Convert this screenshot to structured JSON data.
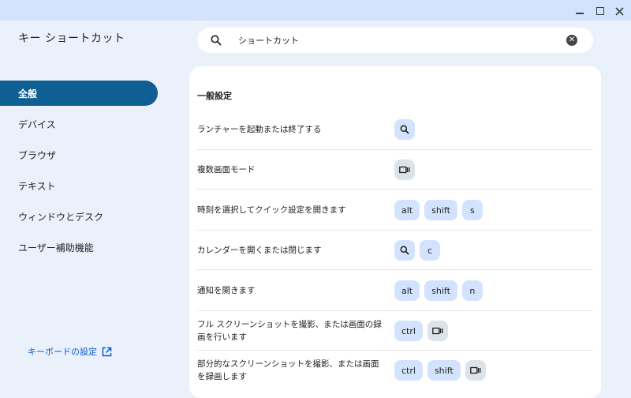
{
  "window": {
    "title": "キー ショートカット"
  },
  "sidebar": {
    "items": [
      {
        "label": "全般"
      },
      {
        "label": "デバイス"
      },
      {
        "label": "ブラウザ"
      },
      {
        "label": "テキスト"
      },
      {
        "label": "ウィンドウとデスク"
      },
      {
        "label": "ユーザー補助機能"
      }
    ],
    "keyboard_settings_link": "キーボードの設定"
  },
  "search": {
    "value": "ショートカット"
  },
  "main": {
    "section_title": "一般設定",
    "shortcuts": [
      {
        "desc": "ランチャーを起動または終了する",
        "keys": [
          {
            "type": "icon",
            "icon": "search-icon"
          }
        ]
      },
      {
        "desc": "複数画面モード",
        "keys": [
          {
            "type": "icon",
            "icon": "overview-icon"
          }
        ]
      },
      {
        "desc": "時刻を選択してクイック設定を開きます",
        "keys": [
          {
            "type": "text",
            "label": "alt"
          },
          {
            "type": "text",
            "label": "shift"
          },
          {
            "type": "text",
            "label": "s"
          }
        ]
      },
      {
        "desc": "カレンダーを開くまたは閉じます",
        "keys": [
          {
            "type": "icon",
            "icon": "search-icon"
          },
          {
            "type": "text",
            "label": "c"
          }
        ]
      },
      {
        "desc": "通知を開きます",
        "keys": [
          {
            "type": "text",
            "label": "alt"
          },
          {
            "type": "text",
            "label": "shift"
          },
          {
            "type": "text",
            "label": "n"
          }
        ]
      },
      {
        "desc": "フル スクリーンショットを撮影、または画面の録画を行います",
        "keys": [
          {
            "type": "text",
            "label": "ctrl"
          },
          {
            "type": "icon",
            "icon": "overview-icon"
          }
        ]
      },
      {
        "desc": "部分的なスクリーンショットを撮影、または画面を録画します",
        "keys": [
          {
            "type": "text",
            "label": "ctrl"
          },
          {
            "type": "text",
            "label": "shift"
          },
          {
            "type": "icon",
            "icon": "overview-icon"
          }
        ]
      }
    ]
  },
  "colors": {
    "accent": "#105f92",
    "key_bg": "#d3e3fd",
    "link": "#0b57d0"
  }
}
